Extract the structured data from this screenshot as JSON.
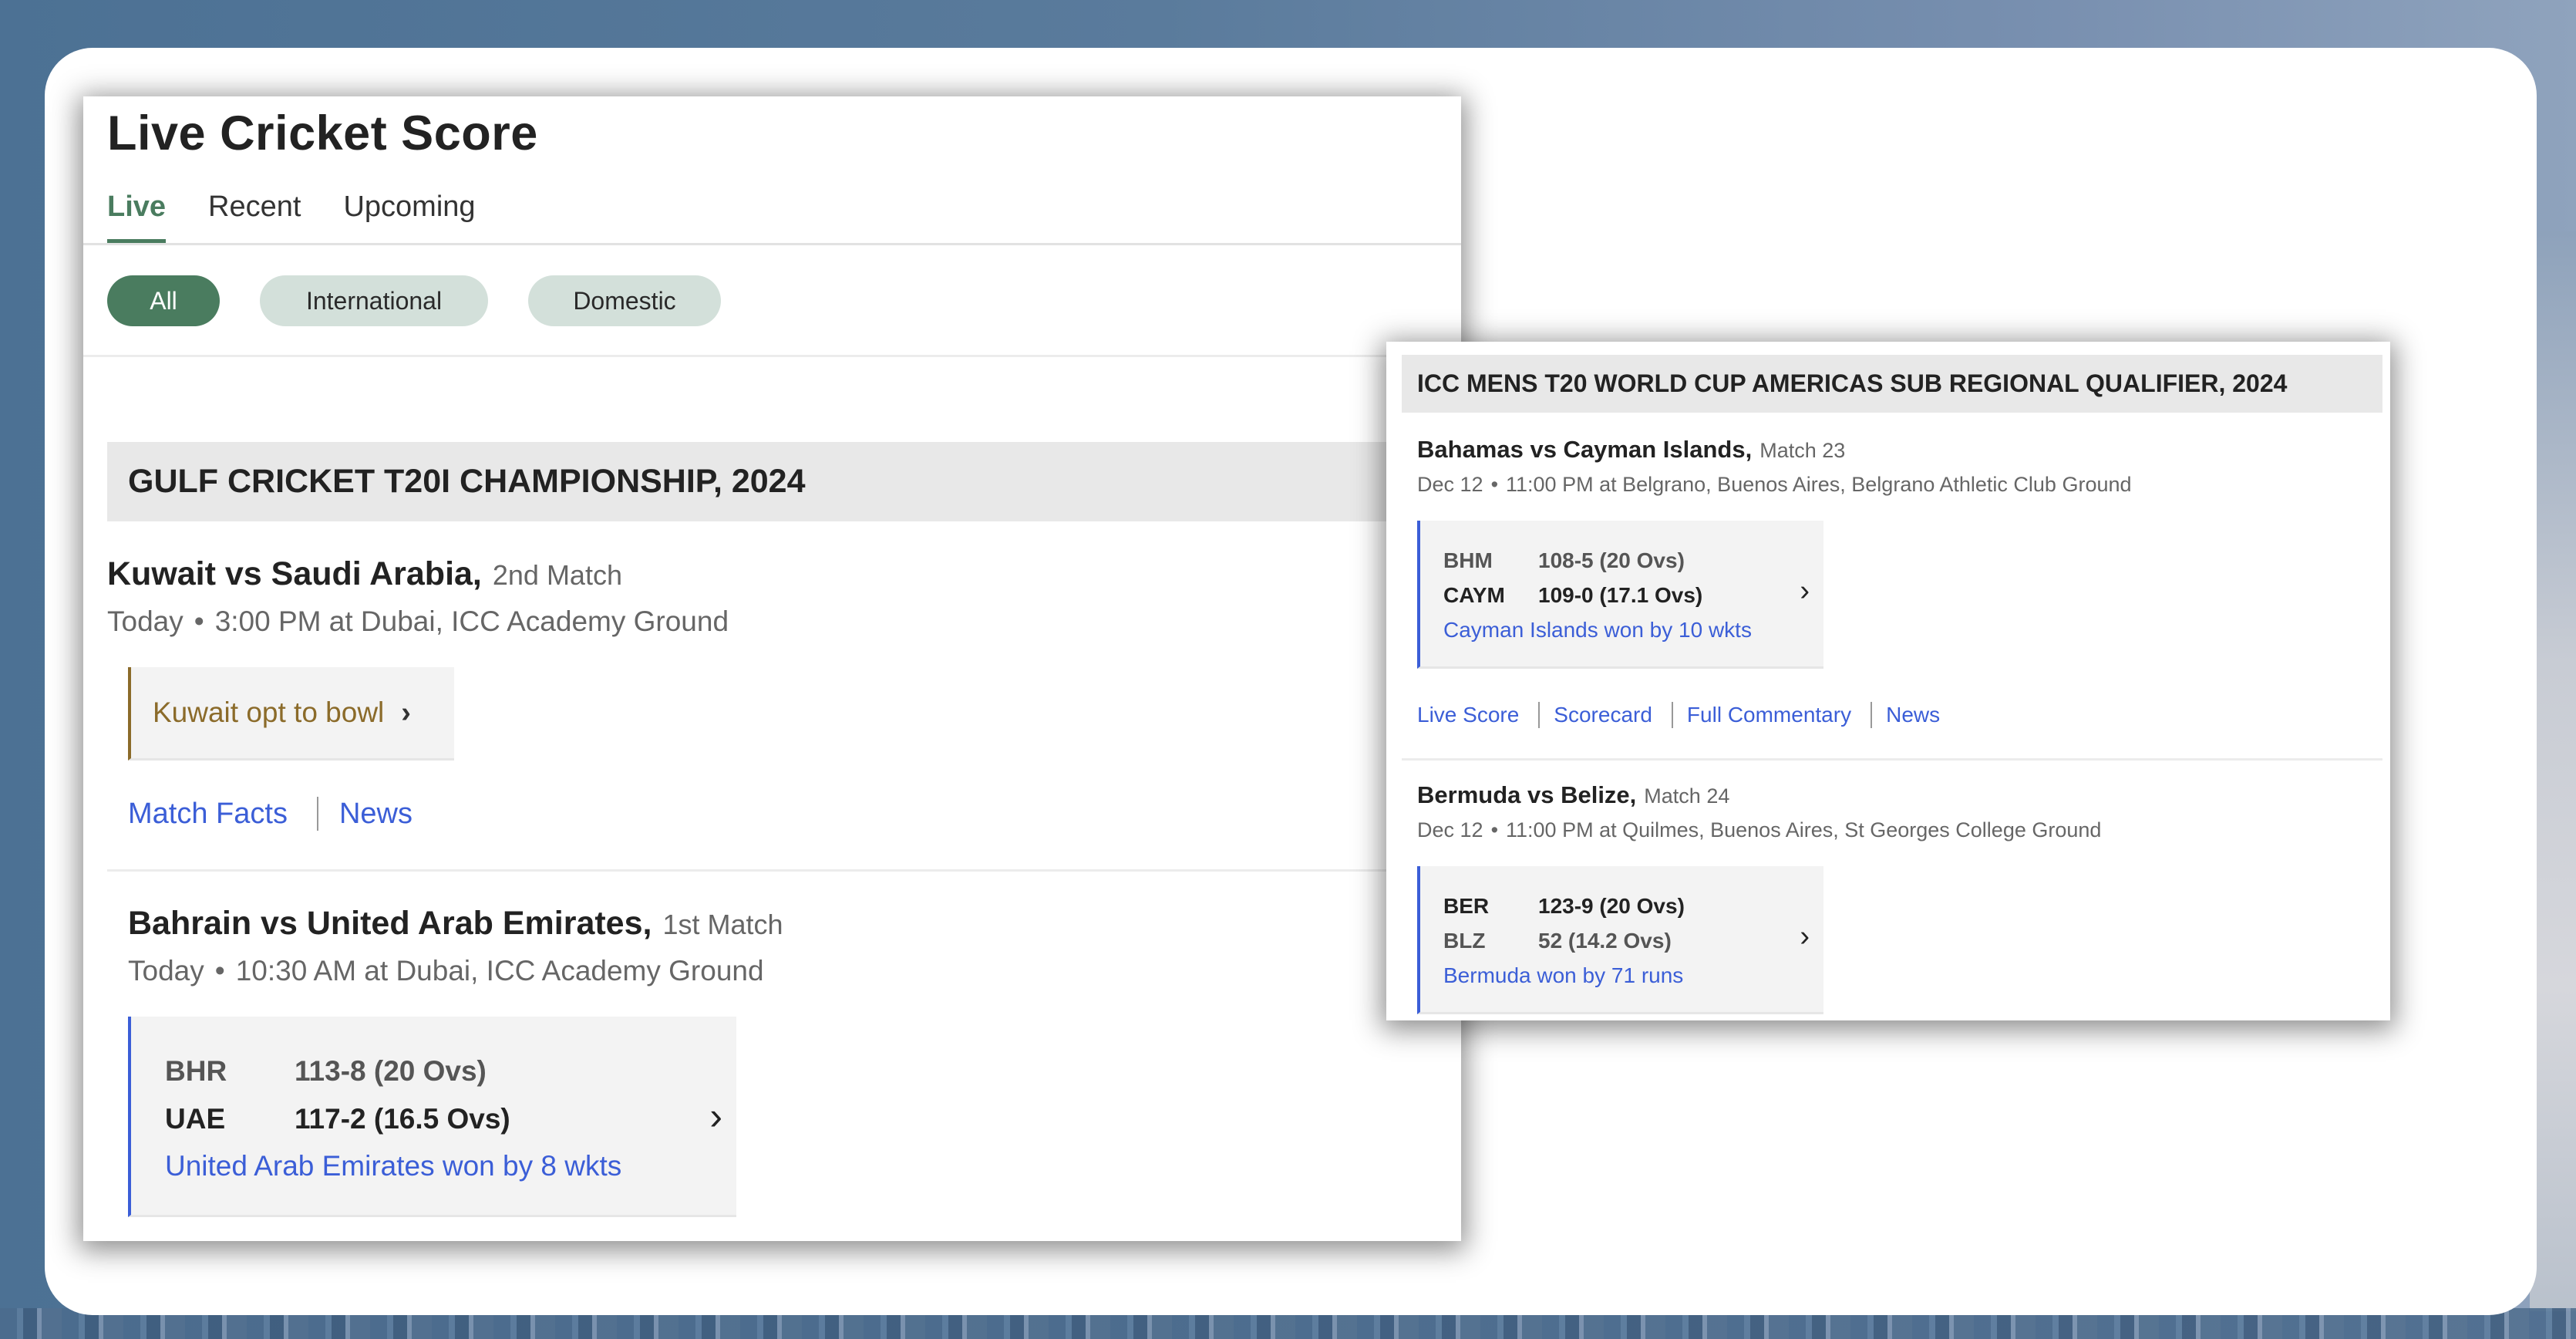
{
  "left_panel": {
    "title": "Live Cricket Score",
    "tabs": [
      {
        "label": "Live",
        "active": true
      },
      {
        "label": "Recent",
        "active": false
      },
      {
        "label": "Upcoming",
        "active": false
      }
    ],
    "filters": [
      {
        "label": "All",
        "active": true
      },
      {
        "label": "International",
        "active": false
      },
      {
        "label": "Domestic",
        "active": false
      }
    ],
    "series": {
      "name": "GULF CRICKET T20I CHAMPIONSHIP, 2024",
      "matches": [
        {
          "teams": "Kuwait vs Saudi Arabia,",
          "match_no": "2nd Match",
          "day": "Today",
          "dot": "•",
          "time_venue": "3:00 PM at Dubai, ICC Academy Ground",
          "status": "Kuwait opt to bowl",
          "status_chevron": "›",
          "links": [
            "Match Facts",
            "News"
          ]
        },
        {
          "teams": "Bahrain vs United Arab Emirates,",
          "match_no": "1st Match",
          "day": "Today",
          "dot": "•",
          "time_venue": "10:30 AM at Dubai, ICC Academy Ground",
          "innings": [
            {
              "team": "BHR",
              "score": "113-8 (20 Ovs)",
              "winner": false
            },
            {
              "team": "UAE",
              "score": "117-2 (16.5 Ovs)",
              "winner": true
            }
          ],
          "result": "United Arab Emirates won by 8 wkts",
          "chevron": "›"
        }
      ]
    }
  },
  "right_panel": {
    "series": {
      "name": "ICC MENS T20 WORLD CUP AMERICAS SUB REGIONAL QUALIFIER, 2024",
      "matches": [
        {
          "teams": "Bahamas vs Cayman Islands,",
          "match_no": "Match 23",
          "day": "Dec 12",
          "dot": "•",
          "time_venue": "11:00 PM at Belgrano, Buenos Aires, Belgrano Athletic Club Ground",
          "innings": [
            {
              "team": "BHM",
              "score": "108-5 (20 Ovs)",
              "winner": false
            },
            {
              "team": "CAYM",
              "score": "109-0 (17.1 Ovs)",
              "winner": true
            }
          ],
          "result": "Cayman Islands won by 10 wkts",
          "chevron": "›",
          "links": [
            "Live Score",
            "Scorecard",
            "Full Commentary",
            "News"
          ]
        },
        {
          "teams": "Bermuda vs Belize,",
          "match_no": "Match 24",
          "day": "Dec 12",
          "dot": "•",
          "time_venue": "11:00 PM at Quilmes, Buenos Aires, St Georges College Ground",
          "innings": [
            {
              "team": "BER",
              "score": "123-9 (20 Ovs)",
              "winner": true
            },
            {
              "team": "BLZ",
              "score": "52 (14.2 Ovs)",
              "winner": false
            }
          ],
          "result": "Bermuda won by 71 runs",
          "chevron": "›"
        }
      ]
    }
  },
  "colors": {
    "accent_green": "#4a7c5f",
    "pill_bg": "#d3e0da",
    "link_blue": "#3b5ed7",
    "status_brown": "#8b6b2a",
    "header_band": "#e8e8e8",
    "background_blue": "#4c7194"
  }
}
